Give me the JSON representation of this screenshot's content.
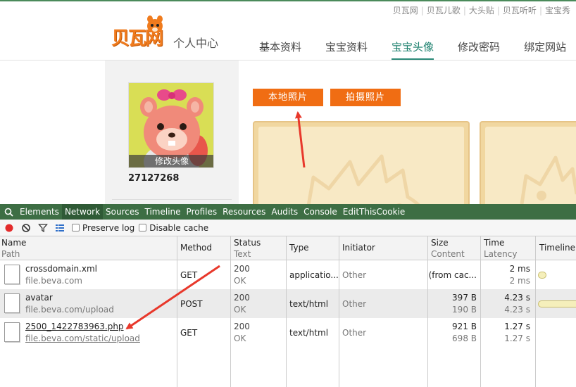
{
  "webpage": {
    "top_links": [
      "贝瓦网",
      "贝瓦儿歌",
      "大头贴",
      "贝瓦听听",
      "宝宝秀"
    ],
    "logo_text": "贝瓦网",
    "subtitle": "个人中心",
    "nav_tabs": [
      {
        "label": "基本资料"
      },
      {
        "label": "宝宝资料"
      },
      {
        "label": "宝宝头像",
        "active": true
      },
      {
        "label": "修改密码"
      },
      {
        "label": "绑定网站"
      }
    ],
    "avatar_change_label": "修改头像",
    "user_id": "27127268",
    "btn_local_photo": "本地照片",
    "btn_shoot_photo": "拍摄照片",
    "colors": {
      "accent_green": "#2b8a78",
      "orange": "#f06d13",
      "devtools_bar": "#3d6e44"
    }
  },
  "devtools": {
    "tabs": [
      {
        "label": "Elements"
      },
      {
        "label": "Network",
        "active": true
      },
      {
        "label": "Sources"
      },
      {
        "label": "Timeline"
      },
      {
        "label": "Profiles"
      },
      {
        "label": "Resources"
      },
      {
        "label": "Audits"
      },
      {
        "label": "Console"
      },
      {
        "label": "EditThisCookie"
      }
    ],
    "toolbar": {
      "preserve_log": "Preserve log",
      "disable_cache": "Disable cache"
    },
    "columns": {
      "name": "Name",
      "path": "Path",
      "method": "Method",
      "status": "Status",
      "text": "Text",
      "type": "Type",
      "initiator": "Initiator",
      "size": "Size",
      "content": "Content",
      "time": "Time",
      "latency": "Latency",
      "timeline": "Timeline"
    },
    "rows": [
      {
        "name": "crossdomain.xml",
        "path": "file.beva.com",
        "method": "GET",
        "status": "200",
        "status_text": "OK",
        "type": "applicatio...",
        "initiator": "Other",
        "size": "(from cac...",
        "content": "",
        "time": "2 ms",
        "latency": "2 ms"
      },
      {
        "name": "avatar",
        "path": "file.beva.com/upload",
        "method": "POST",
        "status": "200",
        "status_text": "OK",
        "type": "text/html",
        "initiator": "Other",
        "size": "397 B",
        "content": "190 B",
        "time": "4.23 s",
        "latency": "4.23 s"
      },
      {
        "name": "2500_1422783963.php",
        "path": "file.beva.com/static/upload",
        "method": "GET",
        "status": "200",
        "status_text": "OK",
        "type": "text/html",
        "initiator": "Other",
        "size": "921 B",
        "content": "698 B",
        "time": "1.27 s",
        "latency": "1.27 s"
      }
    ]
  }
}
